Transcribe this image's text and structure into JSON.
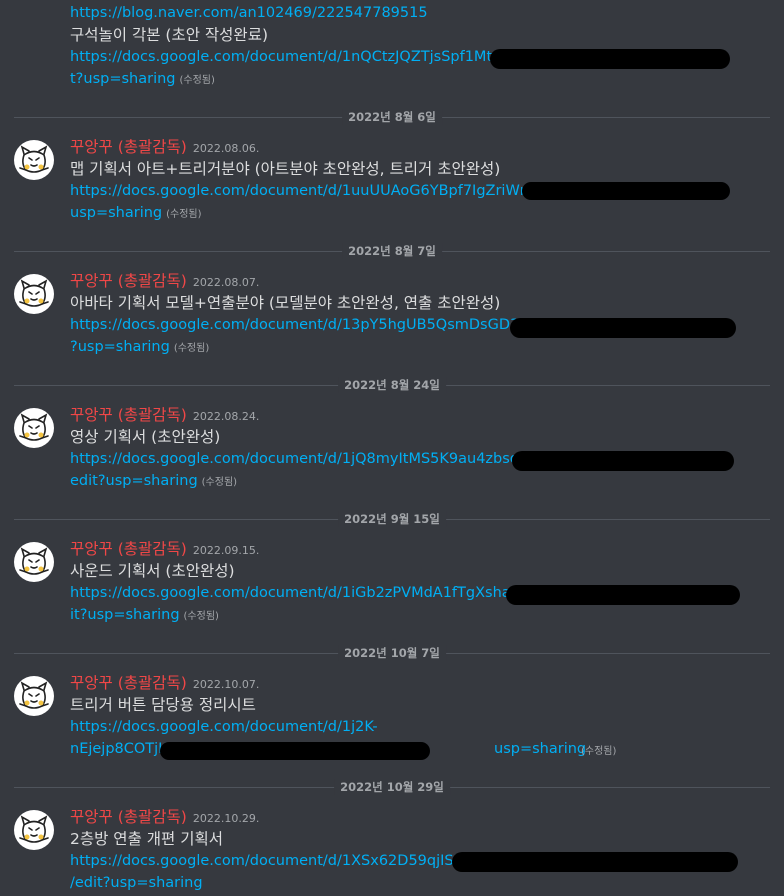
{
  "partial_message": {
    "link1": "https://blog.naver.com/an102469/222547789515",
    "text": "구석놀이 각본 (초안 작성완료)",
    "link2_line1": "https://docs.google.com/document/d/1nQCtzJQZTjsSpf1MtuzG",
    "link2_line2": "t?usp=sharing",
    "edited": "(수정됨)"
  },
  "author": {
    "username": "꾸앙꾸 (총괄감독)"
  },
  "edited_label": "(수정됨)",
  "messages": [
    {
      "date_divider": "2022년 8월 6일",
      "timestamp": "2022.08.06.",
      "text": "맵 기획서 아트+트리거분야 (아트분야 초안완성, 트리거 초안완성)",
      "link_line1": "https://docs.google.com/document/d/1uuUUAoG6YBpf7IgZriWn1lS",
      "link_line2": "usp=sharing"
    },
    {
      "date_divider": "2022년 8월 7일",
      "timestamp": "2022.08.07.",
      "text": "아바타 기획서 모델+연출분야 (모델분야 초안완성, 연출 초안완성)",
      "link_line1": "https://docs.google.com/document/d/13pY5hgUB5QsmDsGD31Lj",
      "link_line2": "?usp=sharing"
    },
    {
      "date_divider": "2022년 8월 24일",
      "timestamp": "2022.08.24.",
      "text": "영상 기획서 (초안완성)",
      "link_line1": "https://docs.google.com/document/d/1jQ8myItMS5K9au4zbsq7v",
      "link_line2": "edit?usp=sharing"
    },
    {
      "date_divider": "2022년 9월 15일",
      "timestamp": "2022.09.15.",
      "text": "사운드 기획서 (초안완성)",
      "link_line1": "https://docs.google.com/document/d/1iGb2zPVMdA1fTgXshabc",
      "link_line2": "it?usp=sharing"
    },
    {
      "date_divider": "2022년 10월 7일",
      "timestamp": "2022.10.07.",
      "text": "트리거 버튼 담당용 정리시트",
      "link_line1": "https://docs.google.com/document/d/1j2K-",
      "link_line2": "nEjejp8COTjK",
      "link_line2_tail": "usp=sharing"
    },
    {
      "date_divider": "2022년 10월 29일",
      "timestamp": "2022.10.29.",
      "text": "2층방 연출 개편 기획서",
      "link_line1": "https://docs.google.com/document/d/1XSx62D59qjISKOj",
      "link_line2": "/edit?usp=sharing"
    }
  ]
}
